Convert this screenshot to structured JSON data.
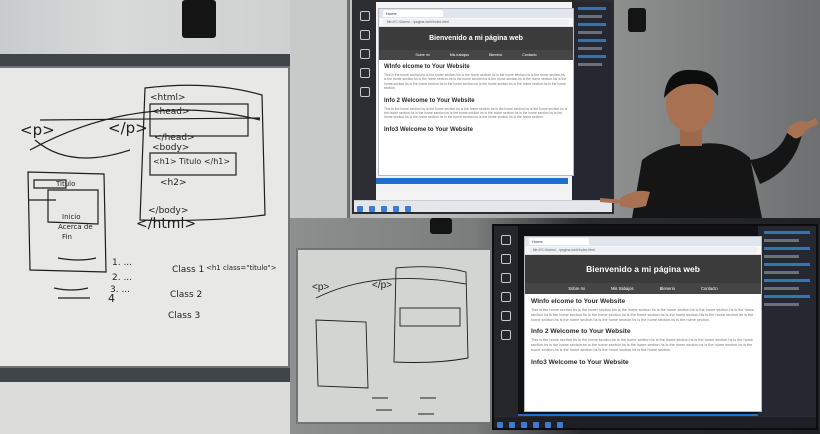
{
  "scene": {
    "panels": [
      "whiteboard-closeup",
      "presenter-at-screen",
      "whiteboard-and-screen"
    ]
  },
  "whiteboard": {
    "html_open": "<html>",
    "head_open": "<head>",
    "head_close": "</head>",
    "body_open": "<body>",
    "title_tag": "<h1> Titulo </h1>",
    "h2": "<h2>",
    "body_close": "</body>",
    "html_close": "</html>",
    "p_open": "<p>",
    "p_close": "</p>",
    "sketch_labels": [
      "Titulo",
      "Inicio",
      "Acerca de",
      "Fin"
    ],
    "numbered": [
      "1. ...",
      "2. ...",
      "3. ...",
      "4"
    ],
    "class_notes": [
      "Class 1",
      "Class 2",
      "Class 3"
    ],
    "note": "<h1 class=\"titulo\">"
  },
  "website": {
    "browser_tab": "Home",
    "url": "file:///C:/Users/.../pagina-web/index.html",
    "title": "Bienvenido a mi página web",
    "nav": [
      "Sobre mi",
      "Mis trabajos",
      "Blenerio",
      "Contacto"
    ],
    "sections": [
      {
        "heading": "WInfo elcome to Your Website",
        "text": "This is the home section.hs is the footer section.his is the home section.hs is the home section.hs is the home section.hs is the home section.hs is the home section.hs is the home section.hs is the home section.hs is the home section.his is the home section.hs is the home section.hs is the home section.hs is the home section.hs is the home section.hs is the home section."
      },
      {
        "heading": "Info 2 Welcome to Your Website",
        "text": "This is the home section.hs is the home section.hs is the home section.hs is the home section.hs is the home section.hs is the home section.hs is the home section.hs is the home section.hs is the home section.hs is the home section.hs is the home section.hs is the home section.hs is the home section.hs is the home section.hs is the home section."
      },
      {
        "heading": "Info3 Welcome to Your Website",
        "text": ""
      }
    ]
  },
  "colors": {
    "site_header": "#3b3b3b",
    "taskbar_accent": "#1f6fd1",
    "ink": "#1e1e1e"
  }
}
